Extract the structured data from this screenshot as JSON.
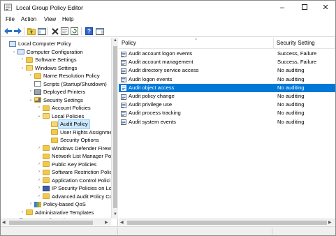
{
  "window": {
    "title": "Local Group Policy Editor",
    "controls": {
      "minimize": "–",
      "maximize": "",
      "close": "✕"
    }
  },
  "menu": [
    "File",
    "Action",
    "View",
    "Help"
  ],
  "toolbar": {
    "buttons": [
      "back-icon",
      "forward-icon",
      "folder-up-icon",
      "show-hide-tree-icon",
      "delete-icon",
      "properties-icon",
      "refresh-icon",
      "export-list-icon",
      "help-icon",
      "show-action-pane-icon"
    ]
  },
  "tree": {
    "items": [
      {
        "label": "Local Computer Policy",
        "level": 0,
        "expander": "",
        "icon": "computer-policy-icon"
      },
      {
        "label": "Computer Configuration",
        "level": 1,
        "expander": "⌄",
        "icon": "computer-icon"
      },
      {
        "label": "Software Settings",
        "level": 2,
        "expander": "›",
        "icon": "folder-icon"
      },
      {
        "label": "Windows Settings",
        "level": 2,
        "expander": "⌄",
        "icon": "folder-icon"
      },
      {
        "label": "Name Resolution Policy",
        "level": 3,
        "expander": "›",
        "icon": "folder-icon"
      },
      {
        "label": "Scripts (Startup/Shutdown)",
        "level": 3,
        "expander": "",
        "icon": "scripts-icon"
      },
      {
        "label": "Deployed Printers",
        "level": 3,
        "expander": "›",
        "icon": "printer-icon"
      },
      {
        "label": "Security Settings",
        "level": 3,
        "expander": "⌄",
        "icon": "security-settings-icon"
      },
      {
        "label": "Account Policies",
        "level": 4,
        "expander": "›",
        "icon": "folder-icon"
      },
      {
        "label": "Local Policies",
        "level": 4,
        "expander": "⌄",
        "icon": "folder-icon"
      },
      {
        "label": "Audit Policy",
        "level": 5,
        "expander": "",
        "icon": "folder-icon",
        "selected": true
      },
      {
        "label": "User Rights Assignmen",
        "level": 5,
        "expander": "",
        "icon": "folder-icon"
      },
      {
        "label": "Security Options",
        "level": 5,
        "expander": "",
        "icon": "folder-icon"
      },
      {
        "label": "Windows Defender Firewal",
        "level": 4,
        "expander": "›",
        "icon": "folder-icon"
      },
      {
        "label": "Network List Manager Poli",
        "level": 4,
        "expander": "",
        "icon": "folder-icon"
      },
      {
        "label": "Public Key Policies",
        "level": 4,
        "expander": "›",
        "icon": "folder-icon"
      },
      {
        "label": "Software Restriction Policie",
        "level": 4,
        "expander": "›",
        "icon": "folder-icon"
      },
      {
        "label": "Application Control Polici",
        "level": 4,
        "expander": "›",
        "icon": "folder-icon"
      },
      {
        "label": "IP Security Policies on Loca",
        "level": 4,
        "expander": "›",
        "icon": "ip-security-icon"
      },
      {
        "label": "Advanced Audit Policy Co",
        "level": 4,
        "expander": "›",
        "icon": "folder-icon"
      },
      {
        "label": "Policy-based QoS",
        "level": 3,
        "expander": "›",
        "icon": "qos-chart-icon"
      },
      {
        "label": "Administrative Templates",
        "level": 2,
        "expander": "›",
        "icon": "folder-icon"
      },
      {
        "label": "User Configuration",
        "level": 1,
        "expander": "›",
        "icon": "user-icon"
      }
    ]
  },
  "list": {
    "columns": {
      "policy": "Policy",
      "setting": "Security Setting"
    },
    "rows": [
      {
        "policy": "Audit account logon events",
        "setting": "Success, Failure"
      },
      {
        "policy": "Audit account management",
        "setting": "Success, Failure"
      },
      {
        "policy": "Audit directory service access",
        "setting": "No auditing"
      },
      {
        "policy": "Audit logon events",
        "setting": "No auditing"
      },
      {
        "policy": "Audit object access",
        "setting": "No auditing",
        "selected": true
      },
      {
        "policy": "Audit policy change",
        "setting": "No auditing"
      },
      {
        "policy": "Audit privilege use",
        "setting": "No auditing"
      },
      {
        "policy": "Audit process tracking",
        "setting": "No auditing"
      },
      {
        "policy": "Audit system events",
        "setting": "No auditing"
      }
    ]
  },
  "colors": {
    "selection": "#0078d7",
    "tree_selection": "#cce8ff",
    "folder": "#f2c94c"
  }
}
